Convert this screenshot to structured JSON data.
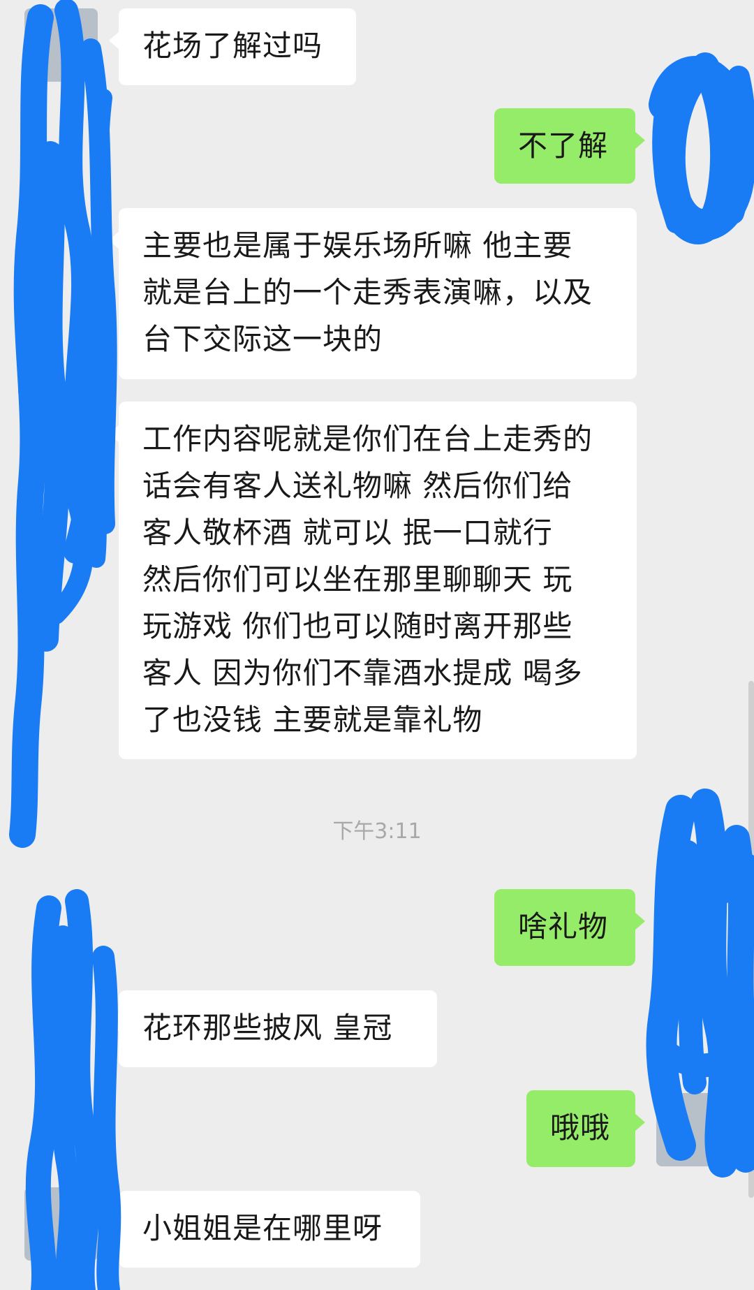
{
  "chat": {
    "messages": [
      {
        "id": "m1",
        "from": "contact",
        "text": "花场了解过吗"
      },
      {
        "id": "m2",
        "from": "me",
        "text": "不了解"
      },
      {
        "id": "m3",
        "from": "contact",
        "text": "主要也是属于娱乐场所嘛 他主要\n就是台上的一个走秀表演嘛，以及\n台下交际这一块的"
      },
      {
        "id": "m4",
        "from": "contact",
        "text": "工作内容呢就是你们在台上走秀的\n话会有客人送礼物嘛   然后你们给\n客人敬杯酒 就可以  抿一口就行\n然后你们可以坐在那里聊聊天  玩\n玩游戏  你们也可以随时离开那些\n客人  因为你们不靠酒水提成  喝多\n了也没钱   主要就是靠礼物"
      },
      {
        "id": "m5",
        "from": "me",
        "text": "啥礼物"
      },
      {
        "id": "m6",
        "from": "contact",
        "text": "花环那些披风  皇冠"
      },
      {
        "id": "m7",
        "from": "me",
        "text": "哦哦"
      },
      {
        "id": "m8",
        "from": "contact",
        "text": "小姐姐是在哪里呀"
      }
    ],
    "timestamp": "下午3:11"
  },
  "colors": {
    "background": "#ededed",
    "incoming_bubble": "#ffffff",
    "outgoing_bubble": "#95ec69",
    "redaction": "#1a7cf5",
    "timestamp_text": "#a8a8a8"
  }
}
